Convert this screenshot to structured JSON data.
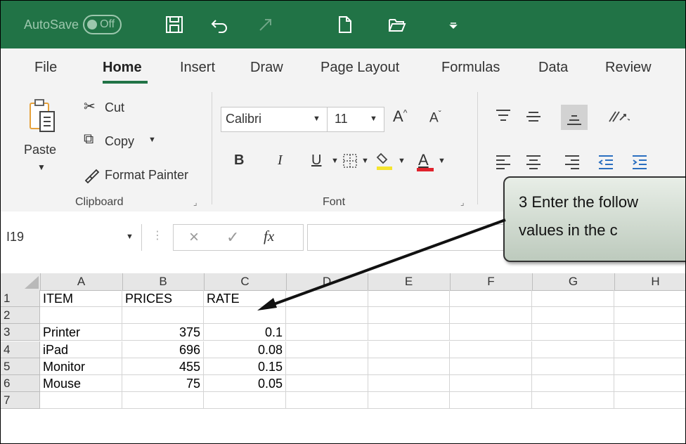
{
  "colors": {
    "excel_green": "#217346",
    "ribbon_bg": "#f3f3f3",
    "callout_bg": "#c9d4c8"
  },
  "titlebar": {
    "autosave_label": "AutoSave",
    "autosave_state": "Off",
    "icons": [
      "save-icon",
      "undo-icon",
      "redo-icon",
      "new-file-icon",
      "open-folder-icon",
      "customize-qat-icon"
    ]
  },
  "tabs": [
    "File",
    "Home",
    "Insert",
    "Draw",
    "Page Layout",
    "Formulas",
    "Data",
    "Review"
  ],
  "active_tab": "Home",
  "clipboard": {
    "paste": "Paste",
    "cut": "Cut",
    "copy": "Copy",
    "format_painter": "Format Painter",
    "group_label": "Clipboard"
  },
  "font": {
    "font_name": "Calibri",
    "font_size": "11",
    "bold": "B",
    "italic": "I",
    "underline": "U",
    "font_color_letter": "A",
    "grow": "A",
    "shrink": "A",
    "group_label": "Font"
  },
  "formula_bar": {
    "name_box": "I19",
    "fx": "fx",
    "cancel": "×",
    "enter": "✓"
  },
  "callout": {
    "line1": "3  Enter the follow",
    "line2": "values in the c"
  },
  "columns": [
    "A",
    "B",
    "C",
    "D",
    "E",
    "F",
    "G",
    "H"
  ],
  "rows": [
    {
      "num": "1",
      "a": "ITEM",
      "b": "PRICES",
      "c": "RATE"
    },
    {
      "num": "2",
      "a": "",
      "b": "",
      "c": ""
    },
    {
      "num": "3",
      "a": "Printer",
      "b": "375",
      "c": "0.1"
    },
    {
      "num": "4",
      "a": "iPad",
      "b": "696",
      "c": "0.08"
    },
    {
      "num": "5",
      "a": "Monitor",
      "b": "455",
      "c": "0.15"
    },
    {
      "num": "6",
      "a": "Mouse",
      "b": "75",
      "c": "0.05"
    },
    {
      "num": "7",
      "a": "",
      "b": "",
      "c": ""
    }
  ]
}
